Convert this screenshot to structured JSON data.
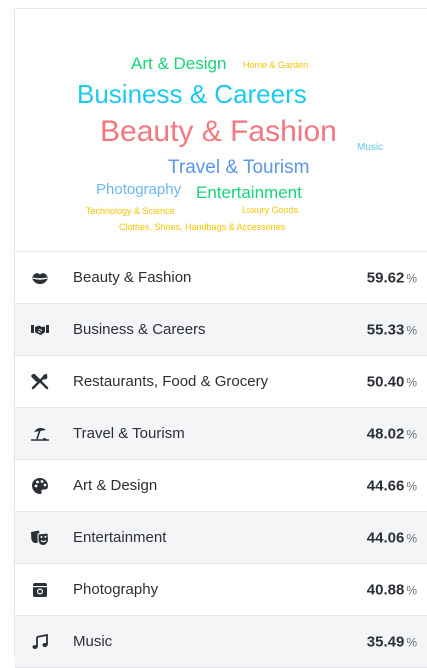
{
  "cloud": {
    "words": [
      {
        "text": "Art & Design",
        "color": "#17d37a"
      },
      {
        "text": "Home & Garden",
        "color": "#f5c400"
      },
      {
        "text": "Business & Careers",
        "color": "#1ec8f0"
      },
      {
        "text": "Beauty & Fashion",
        "color": "#f4777f"
      },
      {
        "text": "Music",
        "color": "#5ec8f5"
      },
      {
        "text": "Travel & Tourism",
        "color": "#5a96ea"
      },
      {
        "text": "Photography",
        "color": "#6cb6f2"
      },
      {
        "text": "Entertainment",
        "color": "#17d37a"
      },
      {
        "text": "Technology & Science",
        "color": "#f5c400"
      },
      {
        "text": "Luxury Goods",
        "color": "#f5c400"
      },
      {
        "text": "Clothes, Shoes, Handbags & Accessories",
        "color": "#f5c400"
      }
    ]
  },
  "interests": [
    {
      "icon": "lips-icon",
      "label": "Beauty & Fashion",
      "value": "59.62",
      "unit": "%"
    },
    {
      "icon": "handshake-icon",
      "label": "Business & Careers",
      "value": "55.33",
      "unit": "%"
    },
    {
      "icon": "utensils-icon",
      "label": "Restaurants, Food & Grocery",
      "value": "50.40",
      "unit": "%"
    },
    {
      "icon": "umbrella-beach-icon",
      "label": "Travel & Tourism",
      "value": "48.02",
      "unit": "%"
    },
    {
      "icon": "palette-icon",
      "label": "Art & Design",
      "value": "44.66",
      "unit": "%"
    },
    {
      "icon": "theater-masks-icon",
      "label": "Entertainment",
      "value": "44.06",
      "unit": "%"
    },
    {
      "icon": "camera-icon",
      "label": "Photography",
      "value": "40.88",
      "unit": "%"
    },
    {
      "icon": "music-note-icon",
      "label": "Music",
      "value": "35.49",
      "unit": "%"
    }
  ]
}
